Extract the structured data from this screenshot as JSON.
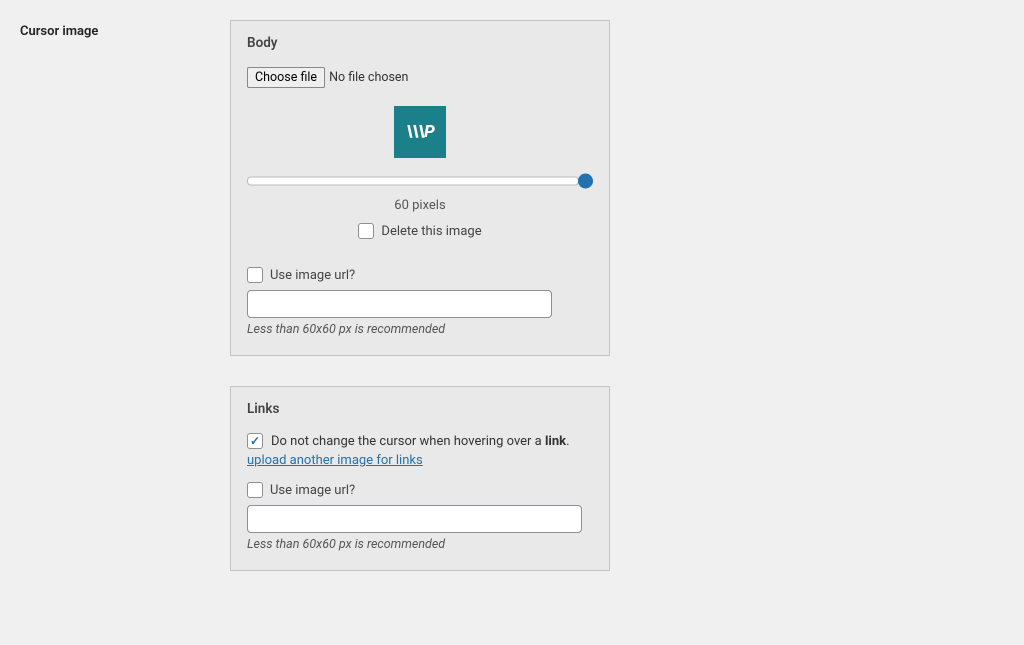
{
  "section_label": "Cursor image",
  "body": {
    "heading": "Body",
    "choose_btn": "Choose file",
    "file_status": "No file chosen",
    "preview_text": "\\\\\\P",
    "slider_value": "60 pixels",
    "delete_label": "Delete this image",
    "use_url_label": "Use image url?",
    "helper": "Less than 60x60 px is recommended"
  },
  "links": {
    "heading": "Links",
    "dont_change_prefix": "Do not change the cursor when hovering over a ",
    "dont_change_bold": "link",
    "dont_change_suffix": ".",
    "upload_another": "upload another image for links",
    "use_url_label": "Use image url?",
    "helper": "Less than 60x60 px is recommended"
  }
}
